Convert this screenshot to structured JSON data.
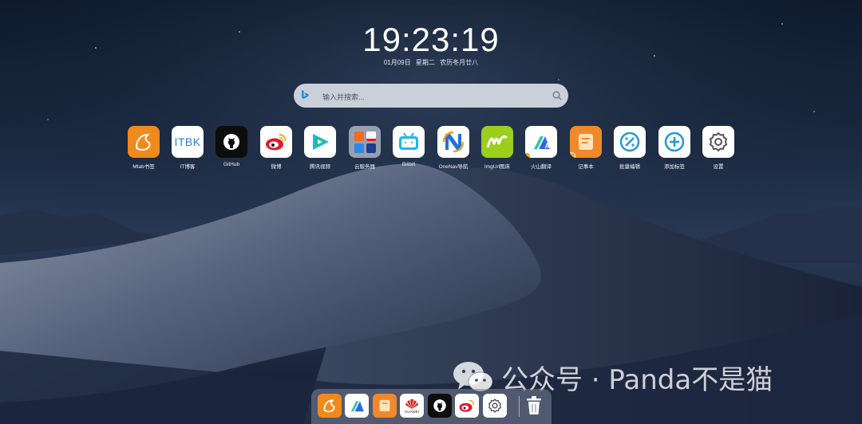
{
  "clock": {
    "time": "19:23:19"
  },
  "date": {
    "day": "01月09日",
    "weekday": "星期二",
    "lunar": "农历冬月廿八"
  },
  "search": {
    "placeholder": "输入并搜索..."
  },
  "apps": [
    {
      "label": "Mtab书签",
      "icon": "mtab-fox-icon"
    },
    {
      "label": "IT博客",
      "icon": "itbk-text-icon",
      "text": "ITBK"
    },
    {
      "label": "GitHub",
      "icon": "github-icon"
    },
    {
      "label": "微博",
      "icon": "weibo-icon"
    },
    {
      "label": "腾讯视频",
      "icon": "tencent-video-icon"
    },
    {
      "label": "云服务器",
      "icon": "cloud-server-folder-icon"
    },
    {
      "label": "Bilibili",
      "icon": "bilibili-tv-icon"
    },
    {
      "label": "OneNav导航",
      "icon": "onenav-icon"
    },
    {
      "label": "ImgUrl图床",
      "icon": "imgurl-icon"
    },
    {
      "label": "火山翻译",
      "icon": "volcano-translate-icon"
    },
    {
      "label": "记事本",
      "icon": "notepad-icon"
    },
    {
      "label": "批量编辑",
      "icon": "batch-edit-icon"
    },
    {
      "label": "添加标签",
      "icon": "add-tag-icon"
    },
    {
      "label": "设置",
      "icon": "gear-icon"
    }
  ],
  "watermark": {
    "text": "公众号 · Panda不是猫",
    "icon": "wechat-icon"
  },
  "dock": [
    {
      "name": "mtab-fox-icon"
    },
    {
      "name": "volcano-translate-icon"
    },
    {
      "name": "notepad-icon"
    },
    {
      "name": "huawei-icon",
      "text": "HUAWEI"
    },
    {
      "name": "github-icon"
    },
    {
      "name": "weibo-icon"
    },
    {
      "name": "gear-icon"
    },
    {
      "name": "trash-icon"
    }
  ]
}
